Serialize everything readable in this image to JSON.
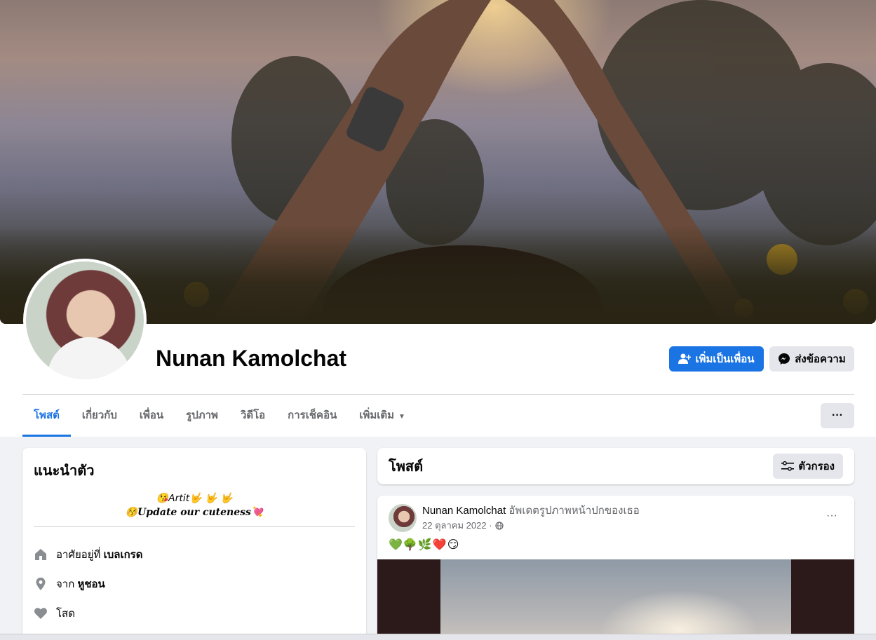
{
  "profile": {
    "name": "Nunan Kamolchat",
    "add_friend_label": "เพิ่มเป็นเพื่อน",
    "message_label": "ส่งข้อความ",
    "more_label": "···"
  },
  "tabs": [
    {
      "label": "โพสต์",
      "active": true
    },
    {
      "label": "เกี่ยวกับ"
    },
    {
      "label": "เพื่อน"
    },
    {
      "label": "รูปภาพ"
    },
    {
      "label": "วิดีโอ"
    },
    {
      "label": "การเช็คอิน"
    },
    {
      "label": "เพิ่มเติม"
    }
  ],
  "intro": {
    "title": "แนะนำตัว",
    "bio_line1": "😘𝘈𝘳𝘵𝘪𝘵🤟 🤟 🤟",
    "bio_line2": "😚𝑼𝒑𝒅𝒂𝒕𝒆 𝒐𝒖𝒓 𝒄𝒖𝒕𝒆𝒏𝒆𝒔𝒔💘",
    "lives_prefix": "อาศัยอยู่ที่",
    "lives_value": "เบลเกรด",
    "from_prefix": "จาก",
    "from_value": "หูชอน",
    "status": "โสด"
  },
  "posts_header": {
    "title": "โพสต์",
    "filter_label": "ตัวกรอง"
  },
  "post": {
    "author": "Nunan Kamolchat",
    "action": "อัพเดตรูปภาพหน้าปกของเธอ",
    "date": "22 ตุลาคม 2022 ·",
    "text": "💚🌳🌿❤️😏",
    "more_label": "···"
  },
  "colors": {
    "primary": "#1b74e4",
    "secondary_bg": "#e4e6eb",
    "page_bg": "#f0f2f5",
    "muted_text": "#65676b"
  }
}
